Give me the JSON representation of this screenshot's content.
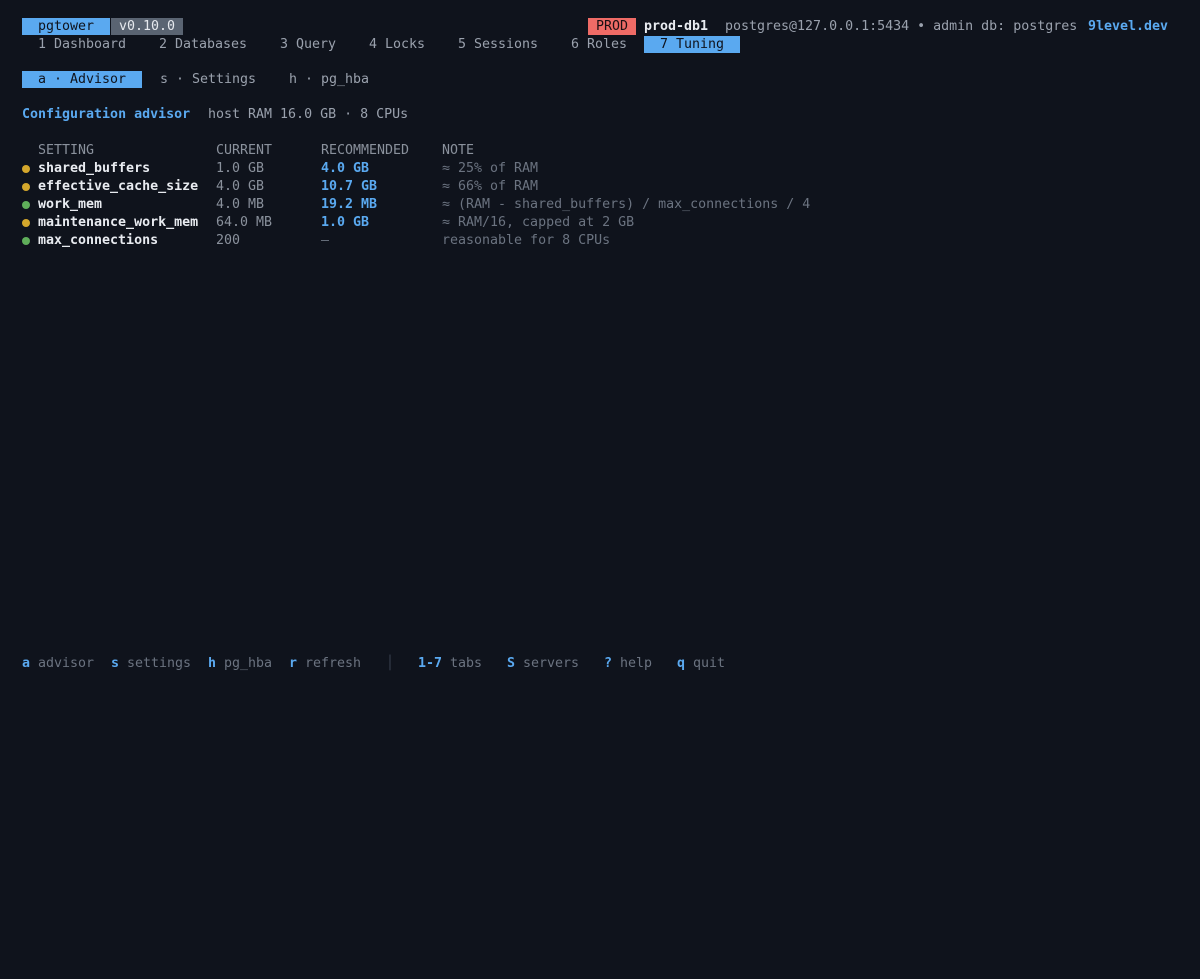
{
  "header": {
    "app_name": "pgtower",
    "version": "v0.10.0",
    "env_badge": "PROD",
    "host": "prod-db1",
    "connection": "postgres@127.0.0.1:5434 • admin db: postgres",
    "site": "9level.dev"
  },
  "tabs": [
    {
      "label": "1 Dashboard",
      "active": false
    },
    {
      "label": "2 Databases",
      "active": false
    },
    {
      "label": "3 Query",
      "active": false
    },
    {
      "label": "4 Locks",
      "active": false
    },
    {
      "label": "5 Sessions",
      "active": false
    },
    {
      "label": "6 Roles",
      "active": false
    },
    {
      "label": "7 Tuning",
      "active": true
    }
  ],
  "subtabs": [
    {
      "label": "a · Advisor",
      "active": true
    },
    {
      "label": "s · Settings",
      "active": false
    },
    {
      "label": "h · pg_hba",
      "active": false
    }
  ],
  "advisor": {
    "title": "Configuration advisor",
    "host_info": "host RAM 16.0 GB · 8 CPUs",
    "columns": {
      "setting": "SETTING",
      "current": "CURRENT",
      "recommended": "RECOMMENDED",
      "note": "NOTE"
    },
    "rows": [
      {
        "status": "warn",
        "setting": "shared_buffers",
        "current": "1.0 GB",
        "recommended": "4.0 GB",
        "note": "≈ 25% of RAM"
      },
      {
        "status": "warn",
        "setting": "effective_cache_size",
        "current": "4.0 GB",
        "recommended": "10.7 GB",
        "note": "≈ 66% of RAM"
      },
      {
        "status": "ok",
        "setting": "work_mem",
        "current": "4.0 MB",
        "recommended": "19.2 MB",
        "note": "≈ (RAM - shared_buffers) / max_connections / 4"
      },
      {
        "status": "warn",
        "setting": "maintenance_work_mem",
        "current": "64.0 MB",
        "recommended": "1.0 GB",
        "note": "≈ RAM/16, capped at 2 GB"
      },
      {
        "status": "ok",
        "setting": "max_connections",
        "current": "200",
        "recommended": "—",
        "note": "reasonable for 8 CPUs"
      }
    ],
    "status_colors": {
      "warn": "#d4a72c",
      "ok": "#5fae5a"
    }
  },
  "footer": {
    "hints": [
      {
        "key": "a",
        "label": "advisor"
      },
      {
        "key": "s",
        "label": "settings"
      },
      {
        "key": "h",
        "label": "pg_hba"
      },
      {
        "key": "r",
        "label": "refresh"
      }
    ],
    "hints2": [
      {
        "key": "1-7",
        "label": "tabs"
      },
      {
        "key": "S",
        "label": "servers"
      },
      {
        "key": "?",
        "label": "help"
      },
      {
        "key": "q",
        "label": "quit"
      }
    ],
    "separator": "│"
  }
}
